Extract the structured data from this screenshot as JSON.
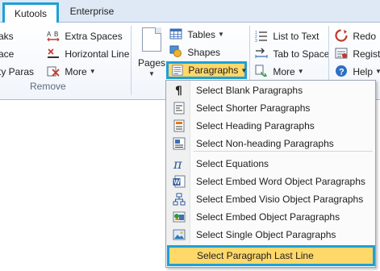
{
  "tabs": {
    "kutools": "Kutools",
    "enterprise": "Enterprise"
  },
  "ribbon": {
    "remove_group": {
      "col1": [
        "aks",
        "ace",
        "ty Paras"
      ],
      "extra_spaces": "Extra Spaces",
      "horizontal_line": "Horizontal Line",
      "more": "More",
      "group_label": "Remove"
    },
    "pages": "Pages",
    "tables": "Tables",
    "shapes": "Shapes",
    "paragraphs": "Paragraphs",
    "list_to_text": "List to Text",
    "tab_to_space": "Tab to Space",
    "more2": "More",
    "redo": "Redo",
    "regist": "Regist",
    "help": "Help"
  },
  "menu": {
    "items": [
      "Select Blank Paragraphs",
      "Select Shorter Paragraphs",
      "Select Heading Paragraphs",
      "Select Non-heading Paragraphs",
      "Select Equations",
      "Select Embed Word Object Paragraphs",
      "Select Embed Visio Object Paragraphs",
      "Select Embed Object Paragraphs",
      "Select Single Object Paragraphs",
      "Select Paragraph Last Line"
    ],
    "icons": [
      "pilcrow-icon",
      "shorter-paragraph-icon",
      "heading-paragraph-icon",
      "non-heading-paragraph-icon",
      "pi-icon",
      "word-object-icon",
      "visio-object-icon",
      "embed-object-icon",
      "single-object-icon",
      "last-line-icon"
    ],
    "highlighted": "Select Paragraph Last Line"
  },
  "colors": {
    "highlight": "#ffd86a",
    "focus_border": "#1ea0d6",
    "ribbon_tabbar": "#dfe9f5"
  }
}
